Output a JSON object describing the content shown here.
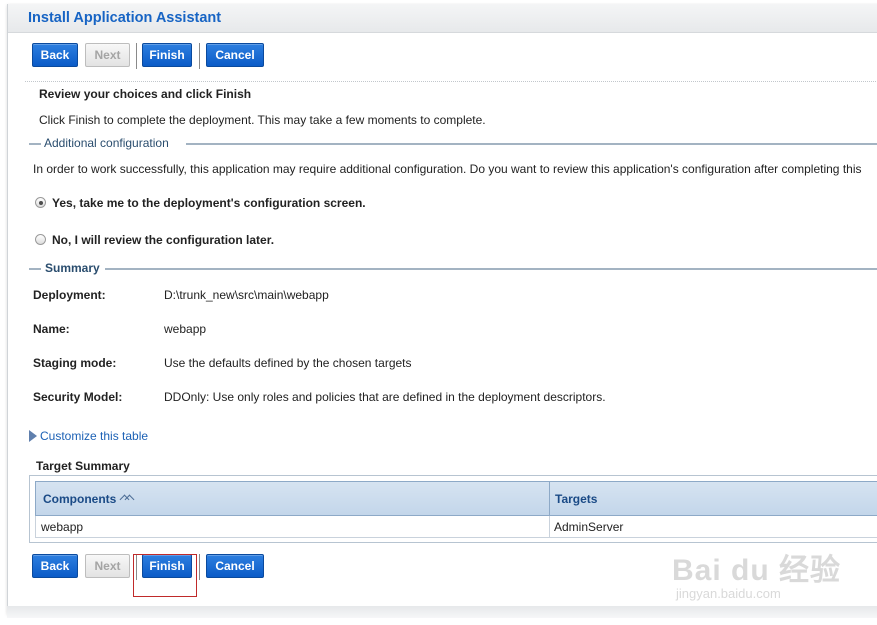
{
  "header": {
    "title": "Install Application Assistant"
  },
  "buttons": {
    "back": "Back",
    "next": "Next",
    "finish": "Finish",
    "cancel": "Cancel"
  },
  "review": {
    "heading": "Review your choices and click Finish",
    "instruction": "Click Finish to complete the deployment. This may take a few moments to complete."
  },
  "additional_config": {
    "legend": "Additional configuration",
    "description": "In order to work successfully, this application may require additional configuration. Do you want to review this application's configuration after completing this",
    "options": [
      {
        "label": "Yes, take me to the deployment's configuration screen.",
        "selected": true
      },
      {
        "label": "No, I will review the configuration later.",
        "selected": false
      }
    ]
  },
  "summary": {
    "legend": "Summary",
    "rows": [
      {
        "label": "Deployment:",
        "value": "D:\\trunk_new\\src\\main\\webapp"
      },
      {
        "label": "Name:",
        "value": "webapp"
      },
      {
        "label": "Staging mode:",
        "value": "Use the defaults defined by the chosen targets"
      },
      {
        "label": "Security Model:",
        "value": "DDOnly: Use only roles and policies that are defined in the deployment descriptors."
      }
    ]
  },
  "customize_link": "Customize this table",
  "target_summary": {
    "title": "Target Summary",
    "columns": [
      "Components",
      "Targets"
    ],
    "rows": [
      {
        "component": "webapp",
        "target": "AdminServer"
      }
    ]
  },
  "watermark": {
    "logo": "Bai du 经验",
    "url": "jingyan.baidu.com"
  },
  "colors": {
    "accent": "#1764c4",
    "button": "#0b5bc7",
    "highlight": "#c02a2a"
  }
}
